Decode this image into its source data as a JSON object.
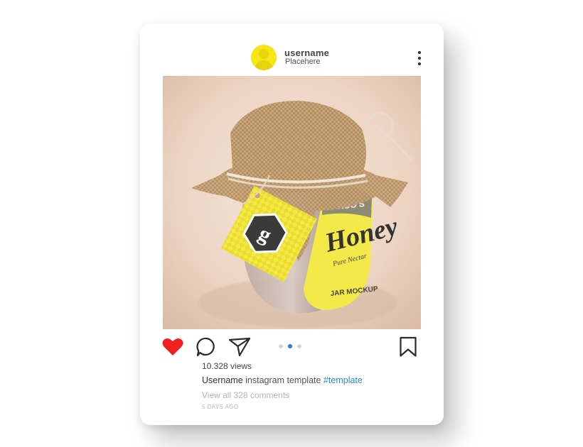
{
  "post": {
    "username": "username",
    "location": "Placehere",
    "views": "10.328 views",
    "caption_user": "Username",
    "caption_text": "instagram template",
    "caption_hashtag": "#template",
    "comments_link": "View all 328 comments",
    "timestamp": "5 DAYS AGO",
    "carousel": {
      "count": 3,
      "active_index": 1
    },
    "liked": true
  },
  "image": {
    "brand": "ROO'S",
    "product": "Honey",
    "script_line": "Pure Nectar",
    "label_text": "JAR MOCKUP",
    "tag_letter": "g"
  },
  "icons": {
    "like": "heart-icon",
    "comment": "comment-bubble-icon",
    "share": "send-paper-plane-icon",
    "save": "bookmark-icon",
    "more": "more-vertical-icon",
    "avatar": "user-avatar-icon"
  },
  "colors": {
    "like_red": "#ef1f1f",
    "hashtag_blue": "#2e86c9",
    "active_dot": "#2c7bd6",
    "avatar_yellow": "#f7e617"
  }
}
